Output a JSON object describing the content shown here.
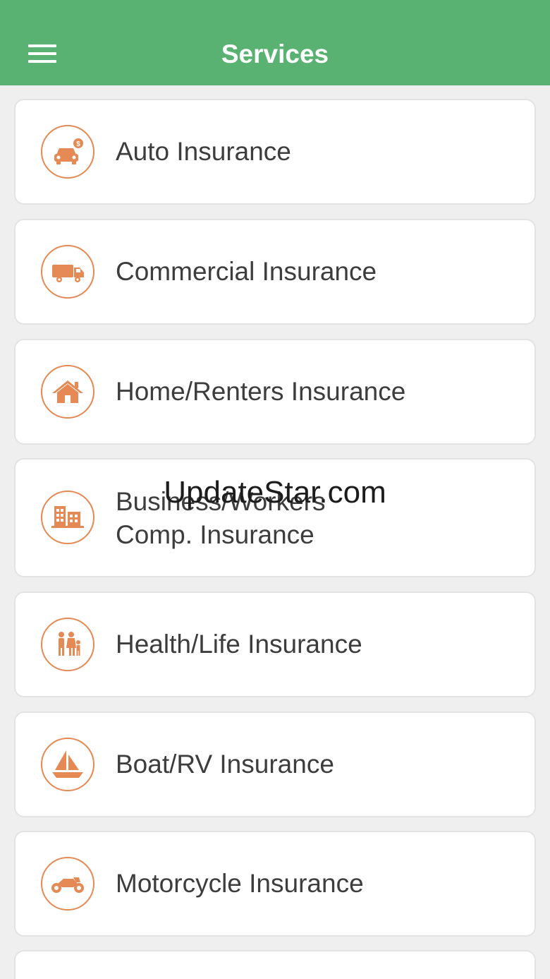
{
  "header": {
    "title": "Services"
  },
  "accent_color": "#e58955",
  "header_color": "#59b271",
  "services": [
    {
      "label": "Auto Insurance",
      "icon": "car-icon"
    },
    {
      "label": "Commercial Insurance",
      "icon": "truck-icon"
    },
    {
      "label": "Home/Renters Insurance",
      "icon": "house-icon"
    },
    {
      "label_line1": "Business/Workers",
      "label_line2": "Comp. Insurance",
      "icon": "building-icon"
    },
    {
      "label": "Health/Life Insurance",
      "icon": "family-icon"
    },
    {
      "label": "Boat/RV Insurance",
      "icon": "sailboat-icon"
    },
    {
      "label": "Motorcycle Insurance",
      "icon": "motorcycle-icon"
    }
  ],
  "watermark": "UpdateStar.com"
}
